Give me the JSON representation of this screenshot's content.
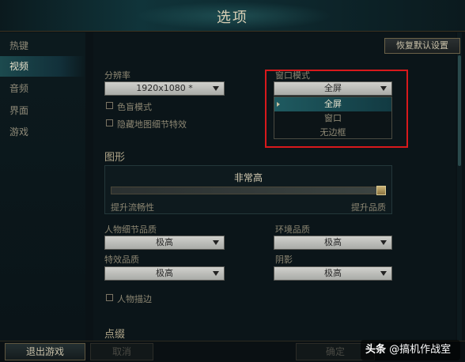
{
  "window": {
    "title": "选项"
  },
  "sidebar": {
    "items": [
      {
        "label": "热键",
        "active": false
      },
      {
        "label": "视频",
        "active": true
      },
      {
        "label": "音频",
        "active": false
      },
      {
        "label": "界面",
        "active": false
      },
      {
        "label": "游戏",
        "active": false
      }
    ]
  },
  "toolbar": {
    "reset_label": "恢复默认设置"
  },
  "video": {
    "resolution_label": "分辨率",
    "resolution_value": "1920x1080 *",
    "colorblind_label": "色盲模式",
    "hide_map_detail_label": "隐藏地图细节特效",
    "window_mode_label": "窗口模式",
    "window_mode_value": "全屏",
    "window_mode_options": [
      "全屏",
      "窗口",
      "无边框"
    ],
    "window_mode_selected": "全屏"
  },
  "graphics": {
    "section_title": "图形",
    "preset_value": "非常高",
    "slider_fraction": 1.0,
    "slider_left_label": "提升流畅性",
    "slider_right_label": "提升品质",
    "character_quality_label": "人物细节品质",
    "character_quality_value": "极高",
    "environment_quality_label": "环境品质",
    "environment_quality_value": "极高",
    "effects_quality_label": "特效品质",
    "effects_quality_value": "极高",
    "shadows_label": "阴影",
    "shadows_value": "极高",
    "character_outline_label": "人物描边"
  },
  "next_section_title": "点缀",
  "footer": {
    "exit_label": "退出游戏",
    "cancel_label": "取消",
    "ok_label": "确定"
  },
  "watermark": {
    "brand": "头条",
    "handle": "@搞机作战室"
  },
  "colors": {
    "highlight_border": "#d8191c",
    "accent_teal": "#1f5a60",
    "gold": "#c9b276"
  }
}
